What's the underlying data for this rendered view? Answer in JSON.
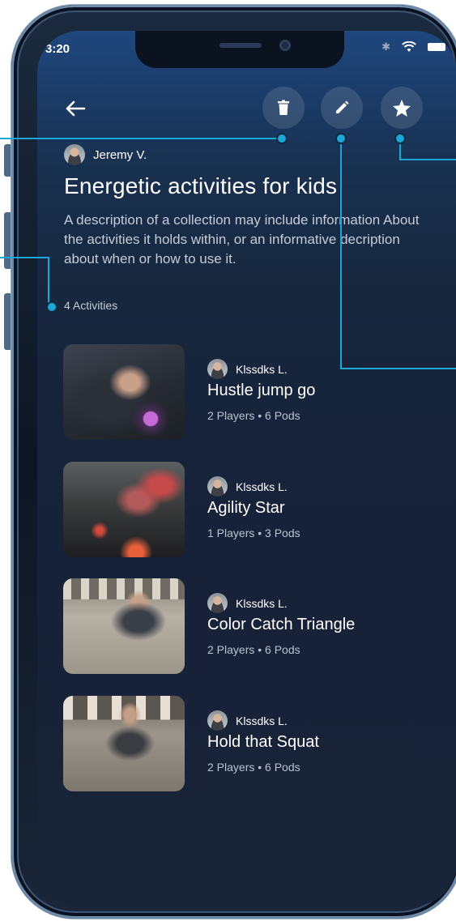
{
  "status": {
    "time": "3:20",
    "bluetooth": "✱"
  },
  "collection": {
    "author": "Jeremy V.",
    "title": "Energetic activities for kids",
    "description": "A description of a collection may include information About the activities it holds within, or an informative decription about when or how to use it.",
    "count": "4 Activities"
  },
  "activities": [
    {
      "author": "Klssdks L.",
      "title": "Hustle jump go",
      "players": "2 Players",
      "pods": "6 Pods"
    },
    {
      "author": "Klssdks L.",
      "title": "Agility Star",
      "players": "1 Players",
      "pods": "3 Pods"
    },
    {
      "author": "Klssdks L.",
      "title": "Color Catch Triangle",
      "players": "2 Players",
      "pods": "6 Pods"
    },
    {
      "author": "Klssdks L.",
      "title": "Hold that Squat",
      "players": "2 Players",
      "pods": "6 Pods"
    }
  ],
  "meta_separator": "•",
  "icons": {
    "back": "arrow-left-icon",
    "delete": "trash-icon",
    "edit": "pencil-icon",
    "favorite": "star-icon"
  },
  "colors": {
    "accent": "#1ca7d4",
    "background": "#16233a",
    "text": "#ffffff",
    "muted_text": "#c4ccd8"
  }
}
